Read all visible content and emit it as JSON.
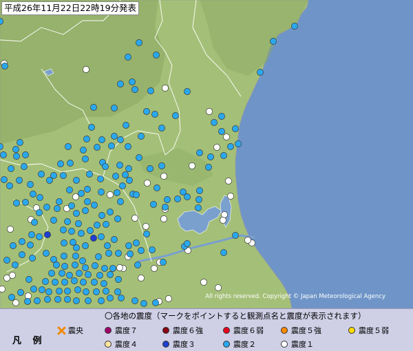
{
  "title": "平成26年11月22日22時19分発表",
  "copyright": "All rights reserved. Copyright © Japan Meteorological Agency",
  "legend": {
    "label": "凡 例",
    "heading": "〇各地の震度（マークをポイントすると観測点名と震度が表示されます）",
    "epicenter": "震央",
    "intensities": [
      {
        "key": "7",
        "label": "震度７",
        "color": "#a0006a"
      },
      {
        "key": "6+",
        "label": "震度６強",
        "color": "#8a0014"
      },
      {
        "key": "6-",
        "label": "震度６弱",
        "color": "#e8001c"
      },
      {
        "key": "5+",
        "label": "震度５強",
        "color": "#ff8a00"
      },
      {
        "key": "5-",
        "label": "震度５弱",
        "color": "#ffdc00"
      },
      {
        "key": "4",
        "label": "震度４",
        "color": "#ffe6a0"
      },
      {
        "key": "3",
        "label": "震度３",
        "color": "#1f3fd0"
      },
      {
        "key": "2",
        "label": "震度２",
        "color": "#2aa8ee"
      },
      {
        "key": "1",
        "label": "震度１",
        "color": "#ffffff"
      }
    ]
  },
  "colors": {
    "sea": "#6f95c8",
    "land": "#a4c078",
    "lake": "#7aa0ce",
    "boundary": "#ffffff"
  },
  "map_stations": {
    "intensity_3": [
      [
        69,
        341
      ],
      [
        136,
        346
      ]
    ],
    "intensity_2": [
      [
        43,
        9
      ],
      [
        0,
        31
      ],
      [
        7,
        96
      ],
      [
        186,
        83
      ],
      [
        202,
        62
      ],
      [
        227,
        80
      ],
      [
        378,
        105
      ],
      [
        397,
        60
      ],
      [
        428,
        38
      ],
      [
        175,
        122
      ],
      [
        192,
        119
      ],
      [
        196,
        130
      ],
      [
        219,
        132
      ],
      [
        272,
        133
      ],
      [
        136,
        156
      ],
      [
        166,
        157
      ],
      [
        213,
        162
      ],
      [
        225,
        166
      ],
      [
        255,
        168
      ],
      [
        322,
        169
      ],
      [
        311,
        178
      ],
      [
        322,
        191
      ],
      [
        342,
        187
      ],
      [
        133,
        185
      ],
      [
        183,
        182
      ],
      [
        235,
        186
      ],
      [
        346,
        209
      ],
      [
        29,
        207
      ],
      [
        0,
        213
      ],
      [
        23,
        217
      ],
      [
        5,
        225
      ],
      [
        24,
        227
      ],
      [
        37,
        225
      ],
      [
        126,
        202
      ],
      [
        148,
        203
      ],
      [
        166,
        198
      ],
      [
        175,
        203
      ],
      [
        205,
        198
      ],
      [
        186,
        213
      ],
      [
        141,
        214
      ],
      [
        162,
        212
      ],
      [
        121,
        218
      ],
      [
        99,
        213
      ],
      [
        124,
        231
      ],
      [
        88,
        238
      ],
      [
        102,
        237
      ],
      [
        149,
        236
      ],
      [
        153,
        242
      ],
      [
        174,
        240
      ],
      [
        202,
        229
      ],
      [
        187,
        245
      ],
      [
        218,
        245
      ],
      [
        235,
        241
      ],
      [
        290,
        222
      ],
      [
        306,
        228
      ],
      [
        303,
        243
      ],
      [
        335,
        213
      ],
      [
        325,
        226
      ],
      [
        16,
        245
      ],
      [
        35,
        242
      ],
      [
        60,
        253
      ],
      [
        72,
        262
      ],
      [
        78,
        255
      ],
      [
        92,
        255
      ],
      [
        111,
        262
      ],
      [
        130,
        253
      ],
      [
        146,
        260
      ],
      [
        168,
        256
      ],
      [
        182,
        254
      ],
      [
        188,
        262
      ],
      [
        101,
        276
      ],
      [
        118,
        281
      ],
      [
        127,
        275
      ],
      [
        147,
        279
      ],
      [
        170,
        280
      ],
      [
        178,
        270
      ],
      [
        193,
        282
      ],
      [
        6,
        261
      ],
      [
        14,
        270
      ],
      [
        28,
        262
      ],
      [
        44,
        268
      ],
      [
        48,
        282
      ],
      [
        58,
        287
      ],
      [
        24,
        295
      ],
      [
        37,
        294
      ],
      [
        86,
        293
      ],
      [
        104,
        299
      ],
      [
        127,
        293
      ],
      [
        137,
        298
      ],
      [
        175,
        293
      ],
      [
        198,
        283
      ],
      [
        243,
        290
      ],
      [
        258,
        289
      ],
      [
        272,
        286
      ],
      [
        289,
        290
      ],
      [
        288,
        302
      ],
      [
        290,
        277
      ],
      [
        266,
        279
      ],
      [
        228,
        273
      ],
      [
        223,
        297
      ],
      [
        240,
        301
      ],
      [
        57,
        309
      ],
      [
        68,
        301
      ],
      [
        83,
        303
      ],
      [
        111,
        310
      ],
      [
        124,
        306
      ],
      [
        148,
        313
      ],
      [
        160,
        308
      ],
      [
        171,
        318
      ],
      [
        50,
        323
      ],
      [
        78,
        320
      ],
      [
        98,
        322
      ],
      [
        114,
        325
      ],
      [
        141,
        327
      ],
      [
        154,
        326
      ],
      [
        46,
        341
      ],
      [
        57,
        344
      ],
      [
        92,
        334
      ],
      [
        104,
        336
      ],
      [
        118,
        339
      ],
      [
        131,
        335
      ],
      [
        147,
        344
      ],
      [
        166,
        348
      ],
      [
        213,
        340
      ],
      [
        19,
        357
      ],
      [
        32,
        351
      ],
      [
        44,
        356
      ],
      [
        93,
        353
      ],
      [
        106,
        352
      ],
      [
        111,
        360
      ],
      [
        124,
        357
      ],
      [
        156,
        357
      ],
      [
        187,
        357
      ],
      [
        198,
        353
      ],
      [
        205,
        364
      ],
      [
        221,
        363
      ],
      [
        268,
        358
      ],
      [
        272,
        354
      ],
      [
        32,
        370
      ],
      [
        47,
        375
      ],
      [
        67,
        368
      ],
      [
        78,
        377
      ],
      [
        93,
        372
      ],
      [
        110,
        372
      ],
      [
        120,
        379
      ],
      [
        143,
        373
      ],
      [
        158,
        368
      ],
      [
        172,
        368
      ],
      [
        189,
        369
      ],
      [
        237,
        381
      ],
      [
        200,
        385
      ],
      [
        10,
        378
      ],
      [
        22,
        385
      ],
      [
        82,
        385
      ],
      [
        94,
        387
      ],
      [
        109,
        385
      ],
      [
        124,
        389
      ],
      [
        138,
        386
      ],
      [
        152,
        390
      ],
      [
        164,
        390
      ],
      [
        75,
        397
      ],
      [
        90,
        397
      ],
      [
        101,
        400
      ],
      [
        115,
        397
      ],
      [
        128,
        399
      ],
      [
        145,
        400
      ],
      [
        160,
        399
      ],
      [
        172,
        406
      ],
      [
        66,
        409
      ],
      [
        80,
        410
      ],
      [
        94,
        410
      ],
      [
        108,
        408
      ],
      [
        121,
        410
      ],
      [
        137,
        410
      ],
      [
        151,
        412
      ],
      [
        42,
        406
      ],
      [
        49,
        420
      ],
      [
        61,
        421
      ],
      [
        71,
        424
      ],
      [
        86,
        423
      ],
      [
        98,
        423
      ],
      [
        113,
        421
      ],
      [
        125,
        424
      ],
      [
        140,
        424
      ],
      [
        154,
        423
      ],
      [
        171,
        424
      ],
      [
        30,
        425
      ],
      [
        17,
        432
      ],
      [
        40,
        438
      ],
      [
        54,
        437
      ],
      [
        69,
        435
      ],
      [
        84,
        435
      ],
      [
        98,
        435
      ],
      [
        111,
        437
      ],
      [
        128,
        437
      ],
      [
        147,
        437
      ],
      [
        160,
        433
      ],
      [
        176,
        433
      ],
      [
        196,
        437
      ],
      [
        209,
        441
      ],
      [
        226,
        440
      ],
      [
        325,
        367
      ],
      [
        342,
        342
      ]
    ],
    "intensity_1": [
      [
        6,
        92
      ],
      [
        125,
        101
      ],
      [
        240,
        128
      ],
      [
        304,
        162
      ],
      [
        329,
        199
      ],
      [
        315,
        214
      ],
      [
        279,
        241
      ],
      [
        238,
        256
      ],
      [
        214,
        266
      ],
      [
        160,
        283
      ],
      [
        97,
        303
      ],
      [
        45,
        319
      ],
      [
        15,
        333
      ],
      [
        53,
        302
      ],
      [
        110,
        286
      ],
      [
        335,
        285
      ],
      [
        332,
        263
      ],
      [
        240,
        304
      ],
      [
        326,
        312
      ],
      [
        324,
        320
      ],
      [
        238,
        318
      ],
      [
        196,
        317
      ],
      [
        212,
        329
      ],
      [
        273,
        364
      ],
      [
        232,
        381
      ],
      [
        224,
        390
      ],
      [
        186,
        373
      ],
      [
        10,
        404
      ],
      [
        18,
        400
      ],
      [
        3,
        420
      ],
      [
        41,
        430
      ],
      [
        23,
        440
      ],
      [
        245,
        434
      ],
      [
        231,
        438
      ],
      [
        317,
        418
      ],
      [
        296,
        410
      ],
      [
        205,
        404
      ],
      [
        179,
        390
      ],
      [
        174,
        389
      ],
      [
        366,
        353
      ],
      [
        360,
        349
      ]
    ]
  }
}
